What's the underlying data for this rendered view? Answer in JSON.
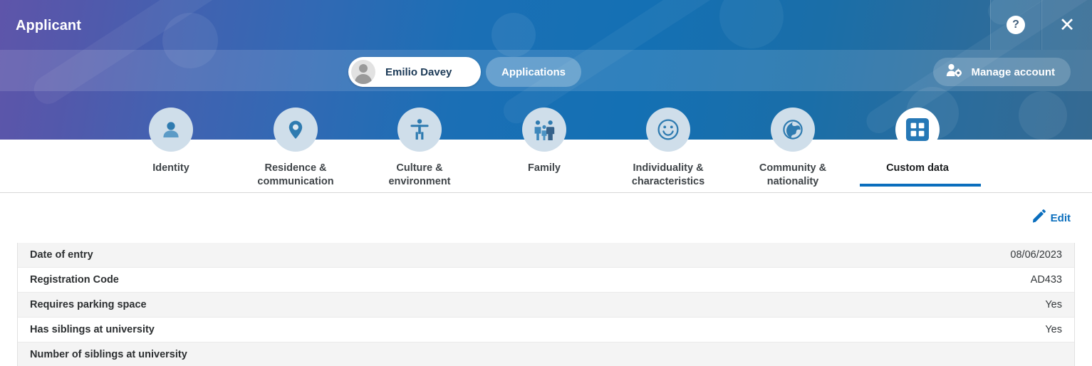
{
  "window": {
    "title": "Applicant",
    "help_icon": "help-circle-icon",
    "help_glyph": "?",
    "close_icon": "close-icon",
    "close_glyph": "✕"
  },
  "header": {
    "user_pill": {
      "name": "Emilio Davey",
      "avatar_icon": "user-avatar-placeholder-icon"
    },
    "applications_button": "Applications",
    "manage_account_button": {
      "label": "Manage account",
      "icon": "user-settings-icon"
    }
  },
  "nav": {
    "tabs": [
      {
        "label": "Identity",
        "icon": "person-icon",
        "active": false
      },
      {
        "label": "Residence &\ncommunication",
        "icon": "location-pin-icon",
        "active": false
      },
      {
        "label": "Culture &\nenvironment",
        "icon": "accessibility-icon",
        "active": false
      },
      {
        "label": "Family",
        "icon": "family-group-icon",
        "active": false
      },
      {
        "label": "Individuality &\ncharacteristics",
        "icon": "smiley-face-icon",
        "active": false
      },
      {
        "label": "Community &\nnationality",
        "icon": "globe-icon",
        "active": false
      },
      {
        "label": "Custom data",
        "icon": "grid-squares-icon",
        "active": true
      }
    ]
  },
  "content": {
    "edit_button": {
      "label": "Edit",
      "icon": "pencil-edit-icon"
    },
    "fields": [
      {
        "label": "Date of entry",
        "value": "08/06/2023"
      },
      {
        "label": "Registration Code",
        "value": "AD433"
      },
      {
        "label": "Requires parking space",
        "value": "Yes"
      },
      {
        "label": "Has siblings at university",
        "value": "Yes"
      },
      {
        "label": "Number of siblings at university",
        "value": ""
      }
    ]
  },
  "colors": {
    "accent_blue": "#0a6ebd",
    "gradient_start": "#5e55aa",
    "gradient_end": "#356a92",
    "row_alt": "#f4f4f4",
    "badge_bg": "#cfdeea"
  }
}
